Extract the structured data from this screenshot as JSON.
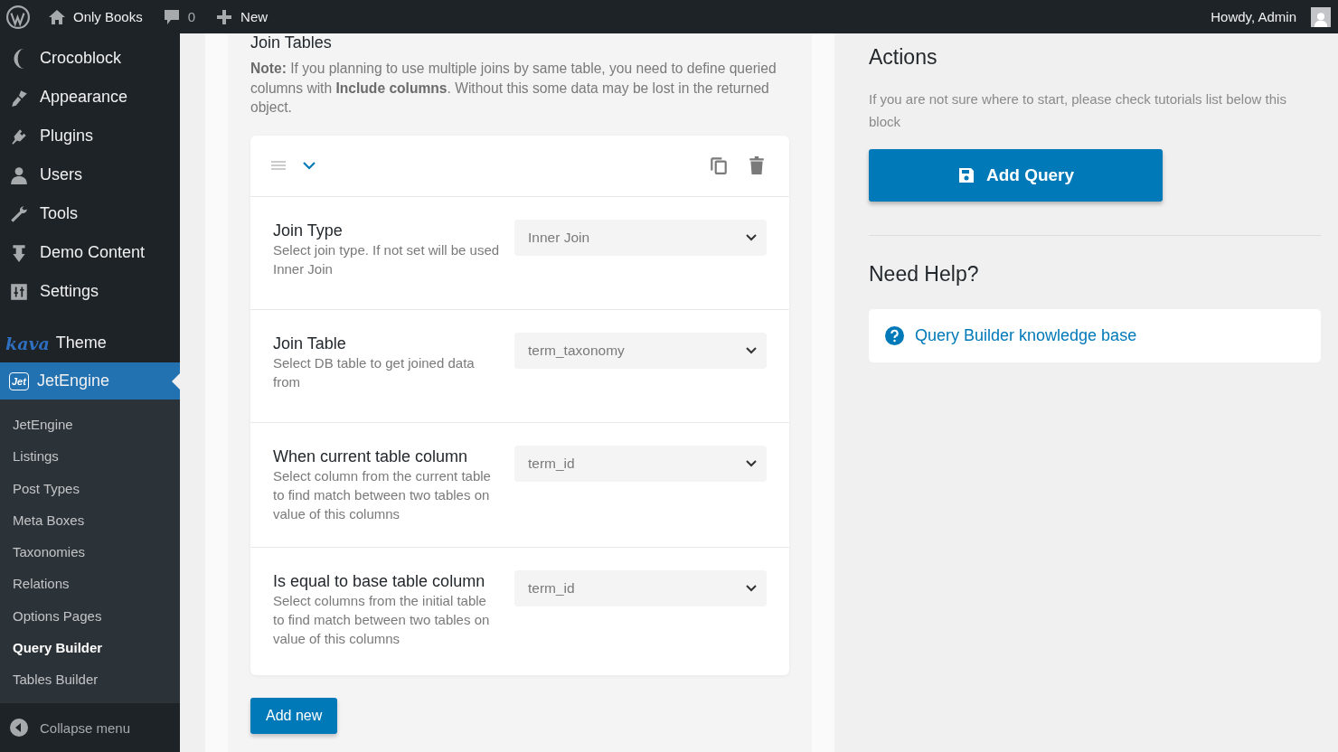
{
  "admin_bar": {
    "site_name": "Only Books",
    "comments_count": "0",
    "new_label": "New",
    "greeting": "Howdy, Admin"
  },
  "sidebar": {
    "items": [
      {
        "label": "Crocoblock",
        "selected": false
      },
      {
        "label": "Appearance",
        "selected": false
      },
      {
        "label": "Plugins",
        "selected": false
      },
      {
        "label": "Users",
        "selected": false
      },
      {
        "label": "Tools",
        "selected": false
      },
      {
        "label": "Demo Content",
        "selected": false
      },
      {
        "label": "Settings",
        "selected": false
      },
      {
        "label": "Theme",
        "logo_text": "kava",
        "selected": false
      },
      {
        "label": "JetEngine",
        "logo_text": "Jet",
        "selected": true
      }
    ],
    "submenu": [
      {
        "label": "JetEngine",
        "selected": false
      },
      {
        "label": "Listings",
        "selected": false
      },
      {
        "label": "Post Types",
        "selected": false
      },
      {
        "label": "Meta Boxes",
        "selected": false
      },
      {
        "label": "Taxonomies",
        "selected": false
      },
      {
        "label": "Relations",
        "selected": false
      },
      {
        "label": "Options Pages",
        "selected": false
      },
      {
        "label": "Query Builder",
        "selected": true
      },
      {
        "label": "Tables Builder",
        "selected": false
      }
    ],
    "collapse_label": "Collapse menu"
  },
  "join_tables": {
    "title": "Join Tables",
    "note": "**Note:** If you planning to use multiple joins by same table, you need to define queried columns with **Include columns**. Without this some data may be lost in the returned object.",
    "expanded": true,
    "fields": [
      {
        "label": "Join Type",
        "description": "Select join type. If not set will be used Inner Join",
        "value": "Inner Join"
      },
      {
        "label": "Join Table",
        "description": "Select DB table to get joined data from",
        "value": "term_taxonomy"
      },
      {
        "label": "When current table column",
        "description": "Select column from the current table to find match between two tables on value of this columns",
        "value": "term_id"
      },
      {
        "label": "Is equal to base table column",
        "description": "Select columns from the initial table to find match between two tables on value of this columns",
        "value": "term_id"
      }
    ],
    "add_button": "Add new"
  },
  "actions": {
    "title": "Actions",
    "text": "If you are not sure where to start, please check tutorials list below this block",
    "button": "Add Query"
  },
  "help": {
    "title": "Need Help?",
    "link": "Query Builder knowledge base"
  }
}
